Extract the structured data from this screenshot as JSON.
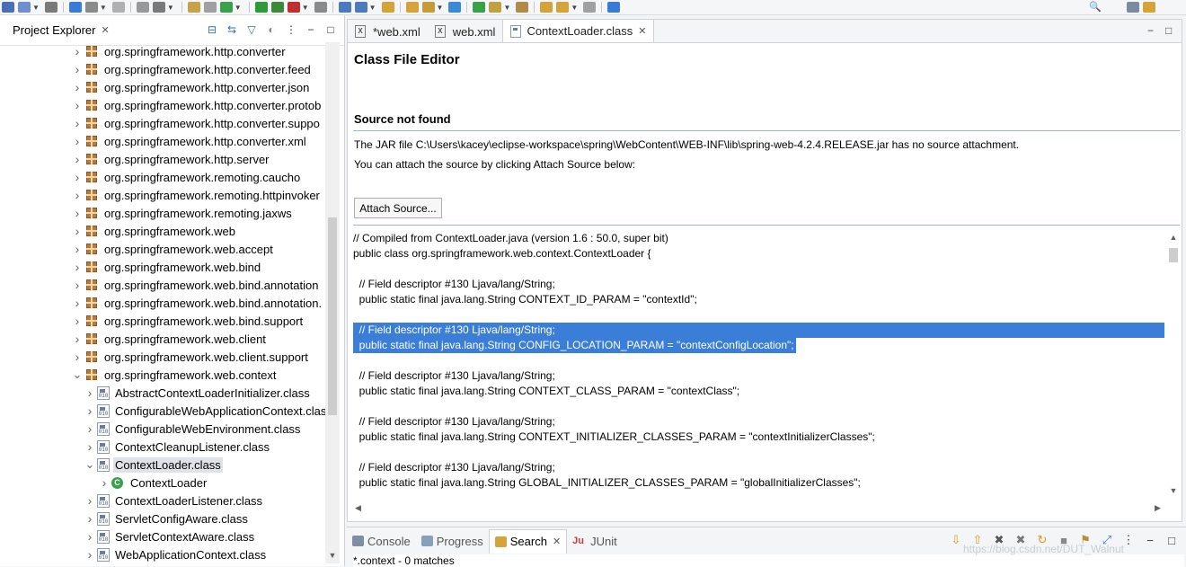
{
  "toolbar": {
    "colors": [
      "#4b6fb5",
      "#6d8fd0",
      "#7a7a7a",
      "#3a7bd5",
      "#8a8a8a",
      "#b0b0b0",
      "#999999",
      "#7a7a7a",
      "#c8a24a",
      "#a0a0a0",
      "#3aa04a",
      "#2e9a3a",
      "#3a8a3a",
      "#c03030",
      "#8a8a8a",
      "#4b7bbf",
      "#4b7bbf",
      "#d6a23a",
      "#d6a23a",
      "#c79a3a",
      "#3a8ad6",
      "#3aa04a",
      "#c0a040",
      "#b08a4a",
      "#d6a23a",
      "#d6a23a",
      "#a0a0a0",
      "#3a7bd5"
    ]
  },
  "project_explorer": {
    "title": "Project Explorer",
    "items": [
      {
        "label": "org.springframework.http.converter",
        "kind": "package",
        "toggle": "collapsed"
      },
      {
        "label": "org.springframework.http.converter.feed",
        "kind": "package",
        "toggle": "collapsed"
      },
      {
        "label": "org.springframework.http.converter.json",
        "kind": "package",
        "toggle": "collapsed"
      },
      {
        "label": "org.springframework.http.converter.protob",
        "kind": "package",
        "toggle": "collapsed"
      },
      {
        "label": "org.springframework.http.converter.suppo",
        "kind": "package",
        "toggle": "collapsed"
      },
      {
        "label": "org.springframework.http.converter.xml",
        "kind": "package",
        "toggle": "collapsed"
      },
      {
        "label": "org.springframework.http.server",
        "kind": "package",
        "toggle": "collapsed"
      },
      {
        "label": "org.springframework.remoting.caucho",
        "kind": "package",
        "toggle": "collapsed"
      },
      {
        "label": "org.springframework.remoting.httpinvoker",
        "kind": "package",
        "toggle": "collapsed"
      },
      {
        "label": "org.springframework.remoting.jaxws",
        "kind": "package",
        "toggle": "collapsed"
      },
      {
        "label": "org.springframework.web",
        "kind": "package",
        "toggle": "collapsed"
      },
      {
        "label": "org.springframework.web.accept",
        "kind": "package",
        "toggle": "collapsed"
      },
      {
        "label": "org.springframework.web.bind",
        "kind": "package",
        "toggle": "collapsed"
      },
      {
        "label": "org.springframework.web.bind.annotation",
        "kind": "package",
        "toggle": "collapsed"
      },
      {
        "label": "org.springframework.web.bind.annotation.",
        "kind": "package",
        "toggle": "collapsed"
      },
      {
        "label": "org.springframework.web.bind.support",
        "kind": "package",
        "toggle": "collapsed"
      },
      {
        "label": "org.springframework.web.client",
        "kind": "package",
        "toggle": "collapsed"
      },
      {
        "label": "org.springframework.web.client.support",
        "kind": "package",
        "toggle": "collapsed"
      },
      {
        "label": "org.springframework.web.context",
        "kind": "package",
        "toggle": "expanded"
      },
      {
        "label": "AbstractContextLoaderInitializer.class",
        "kind": "class",
        "toggle": "collapsed"
      },
      {
        "label": "ConfigurableWebApplicationContext.clas",
        "kind": "class",
        "toggle": "collapsed"
      },
      {
        "label": "ConfigurableWebEnvironment.class",
        "kind": "class",
        "toggle": "collapsed"
      },
      {
        "label": "ContextCleanupListener.class",
        "kind": "class",
        "toggle": "collapsed"
      },
      {
        "label": "ContextLoader.class",
        "kind": "class",
        "toggle": "expanded",
        "selected": true
      },
      {
        "label": "ContextLoader",
        "kind": "type",
        "toggle": "collapsed"
      },
      {
        "label": "ContextLoaderListener.class",
        "kind": "class",
        "toggle": "collapsed"
      },
      {
        "label": "ServletConfigAware.class",
        "kind": "class",
        "toggle": "collapsed"
      },
      {
        "label": "ServletContextAware.class",
        "kind": "class",
        "toggle": "collapsed"
      },
      {
        "label": "WebApplicationContext.class",
        "kind": "class",
        "toggle": "collapsed"
      }
    ],
    "binary_icon_text": "010"
  },
  "editor": {
    "tabs": [
      {
        "label": "*web.xml",
        "icon": "xml-file-icon",
        "active": false
      },
      {
        "label": "web.xml",
        "icon": "xml-file-icon",
        "active": false
      },
      {
        "label": "ContextLoader.class",
        "icon": "class-file-icon",
        "active": true
      }
    ],
    "heading": "Class File Editor",
    "source_not_found": "Source not found",
    "jar_message": "The JAR file C:\\Users\\kacey\\eclipse-workspace\\spring\\WebContent\\WEB-INF\\lib\\spring-web-4.2.4.RELEASE.jar has no source attachment.",
    "attach_message": "You can attach the source by clicking Attach Source below:",
    "attach_button": "Attach Source...",
    "code_lines": [
      {
        "text": "// Compiled from ContextLoader.java (version 1.6 : 50.0, super bit)",
        "highlight": false
      },
      {
        "text": "public class org.springframework.web.context.ContextLoader {",
        "highlight": false
      },
      {
        "text": "",
        "highlight": false
      },
      {
        "text": "  // Field descriptor #130 Ljava/lang/String;",
        "highlight": false
      },
      {
        "text": "  public static final java.lang.String CONTEXT_ID_PARAM = \"contextId\";",
        "highlight": false
      },
      {
        "text": "",
        "highlight": false
      },
      {
        "text": "  // Field descriptor #130 Ljava/lang/String;",
        "highlight": true
      },
      {
        "text": "  public static final java.lang.String CONFIG_LOCATION_PARAM = \"contextConfigLocation\";",
        "highlight": true
      },
      {
        "text": "",
        "highlight": false
      },
      {
        "text": "  // Field descriptor #130 Ljava/lang/String;",
        "highlight": false
      },
      {
        "text": "  public static final java.lang.String CONTEXT_CLASS_PARAM = \"contextClass\";",
        "highlight": false
      },
      {
        "text": "",
        "highlight": false
      },
      {
        "text": "  // Field descriptor #130 Ljava/lang/String;",
        "highlight": false
      },
      {
        "text": "  public static final java.lang.String CONTEXT_INITIALIZER_CLASSES_PARAM = \"contextInitializerClasses\";",
        "highlight": false
      },
      {
        "text": "",
        "highlight": false
      },
      {
        "text": "  // Field descriptor #130 Ljava/lang/String;",
        "highlight": false
      },
      {
        "text": "  public static final java.lang.String GLOBAL_INITIALIZER_CLASSES_PARAM = \"globalInitializerClasses\";",
        "highlight": false
      }
    ],
    "selection_color": "#3b7ed8"
  },
  "bottom_panel": {
    "tabs": [
      {
        "label": "Console",
        "active": false,
        "icon_color": "#7f8ea3"
      },
      {
        "label": "Progress",
        "active": false,
        "icon_color": "#8aa0b8"
      },
      {
        "label": "Search",
        "active": true,
        "icon_color": "#d6a23a"
      },
      {
        "label": "JUnit",
        "active": false,
        "icon_color": "#c04040",
        "icon_text": "Ju"
      }
    ],
    "result": "*.context - 0 matches"
  },
  "watermark": "https://blog.csdn.net/DUT_Walnut"
}
